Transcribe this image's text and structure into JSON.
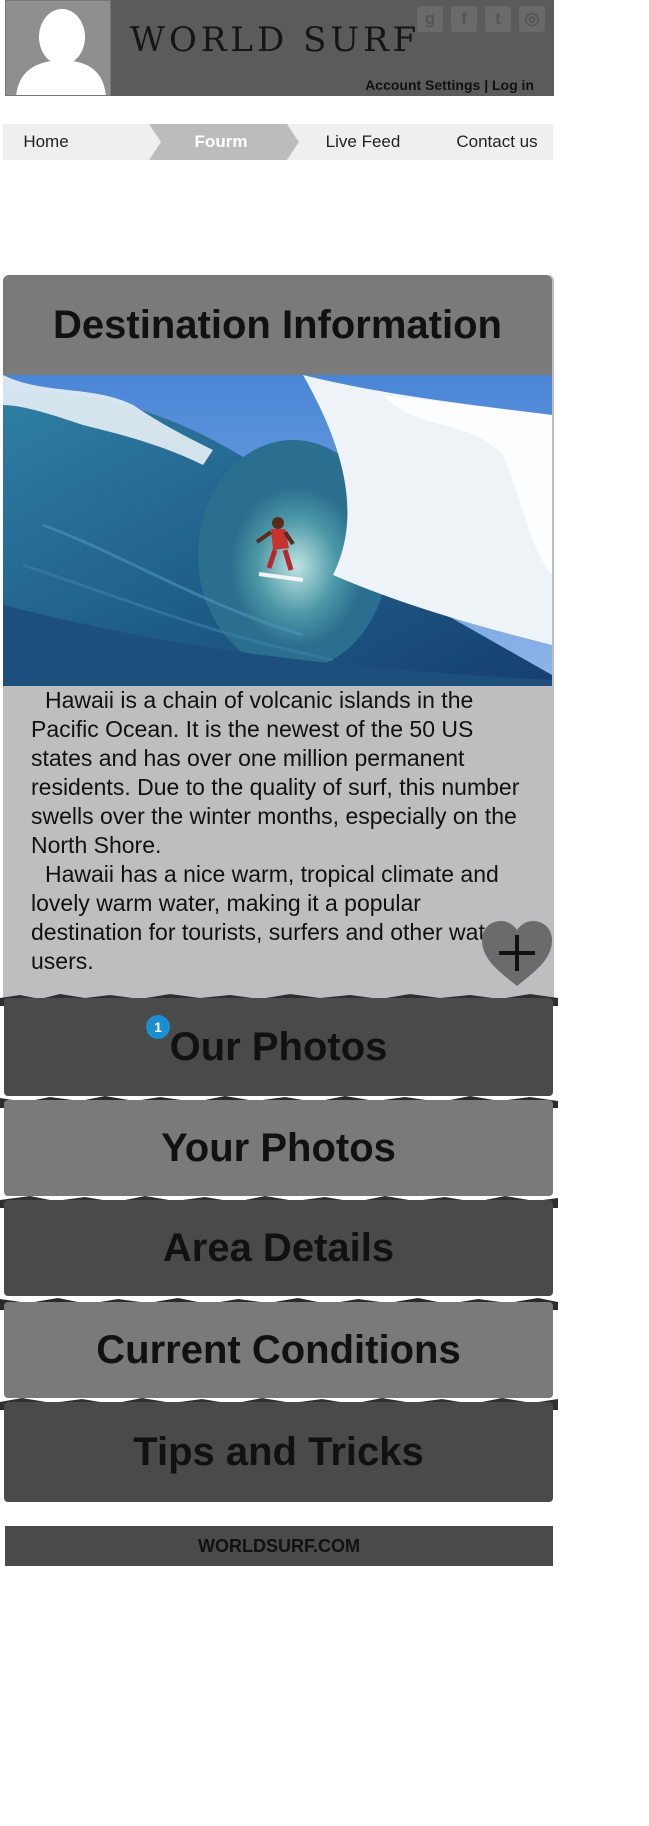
{
  "header": {
    "logo": "WORLD SURF",
    "account_settings": "Account Settings",
    "separator": "|",
    "log_in": "Log in",
    "social": [
      {
        "icon": "google-icon",
        "glyph": "g"
      },
      {
        "icon": "facebook-icon",
        "glyph": "f"
      },
      {
        "icon": "twitter-icon",
        "glyph": "t"
      },
      {
        "icon": "instagram-icon",
        "glyph": "◎"
      }
    ]
  },
  "nav": {
    "items": [
      {
        "label": "Home",
        "active": false
      },
      {
        "label": "Fourm",
        "active": true
      },
      {
        "label": "Live Feed",
        "active": false
      },
      {
        "label": "Contact us",
        "active": false
      }
    ]
  },
  "destination": {
    "title": "Destination Information",
    "paragraph_1": "Hawaii is a chain of volcanic islands in the Pacific Ocean. It is the newest of the 50 US states and has over one million permanent residents. Due to the quality of surf, this number swells over the winter months, especially on the North Shore.",
    "paragraph_2": "Hawaii has a nice warm, tropical climate and lovely warm water, making it a popular destination for tourists, surfers and other water users."
  },
  "sections": {
    "our_photos": "Our Photos",
    "our_photos_badge": "1",
    "your_photos": "Your Photos",
    "area_details": "Area Details",
    "current_conditions": "Current Conditions",
    "tips_and_tricks": "Tips and Tricks"
  },
  "footer": {
    "site": "WORLDSURF.COM"
  },
  "colors": {
    "header_bg": "#5b5b5b",
    "panel_bg": "#bebec1",
    "dark_section": "#4a4a4a",
    "mid_section": "#7a7a7a",
    "badge": "#1a8fcf"
  }
}
